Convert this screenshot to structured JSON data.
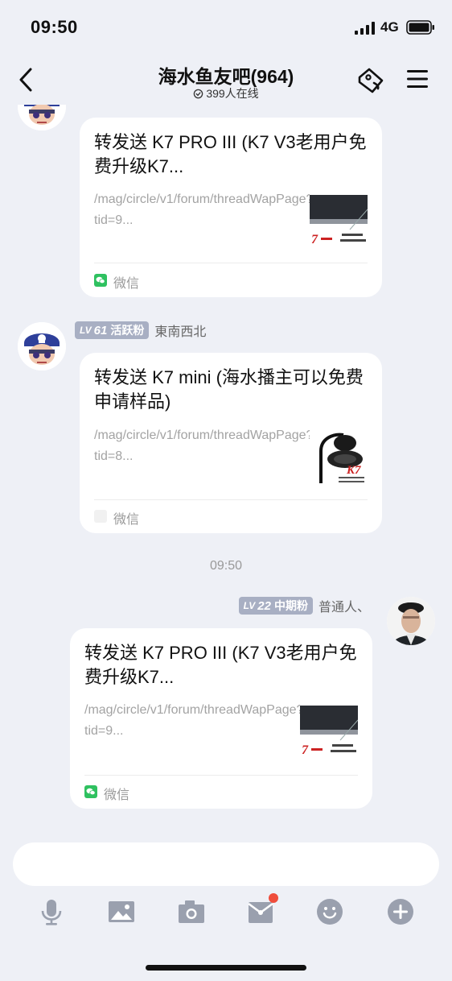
{
  "status": {
    "time": "09:50",
    "network": "4G"
  },
  "header": {
    "title": "海水鱼友吧(964)",
    "online": "399人在线"
  },
  "messages": [
    {
      "side": "left",
      "card": {
        "title": "转发送 K7 PRO III (K7 V3老用户免费升级K7...",
        "url": "/mag/circle/v1/forum/threadWapPage?tid=9...",
        "thumb_text": "7",
        "source": "微信"
      }
    },
    {
      "side": "left",
      "sender": {
        "lv_prefix": "LV",
        "lv": "61",
        "rank": "活跃粉",
        "name": "東南西北"
      },
      "card": {
        "title": "转发送 K7 mini (海水播主可以免费申请样品)",
        "url": "/mag/circle/v1/forum/threadWapPage?tid=8...",
        "thumb_text": "K7",
        "source": "微信"
      }
    },
    {
      "timestamp": "09:50"
    },
    {
      "side": "right",
      "sender": {
        "lv_prefix": "LV",
        "lv": "22",
        "rank": "中期粉",
        "name": "普通人、"
      },
      "card": {
        "title": "转发送 K7 PRO III (K7 V3老用户免费升级K7...",
        "url": "/mag/circle/v1/forum/threadWapPage?tid=9...",
        "thumb_text": "7",
        "source": "微信"
      }
    }
  ],
  "input": {
    "placeholder": ""
  },
  "toolbar": {
    "items": [
      "microphone-icon",
      "image-icon",
      "camera-icon",
      "gift-envelope-icon",
      "emoji-icon",
      "plus-icon"
    ],
    "notification_color": "#ef4d3c"
  },
  "colors": {
    "background": "#eef0f6",
    "badge": "#a8afc3",
    "wechat_green": "#2fc160",
    "icon_gray": "#9aa0ae"
  }
}
